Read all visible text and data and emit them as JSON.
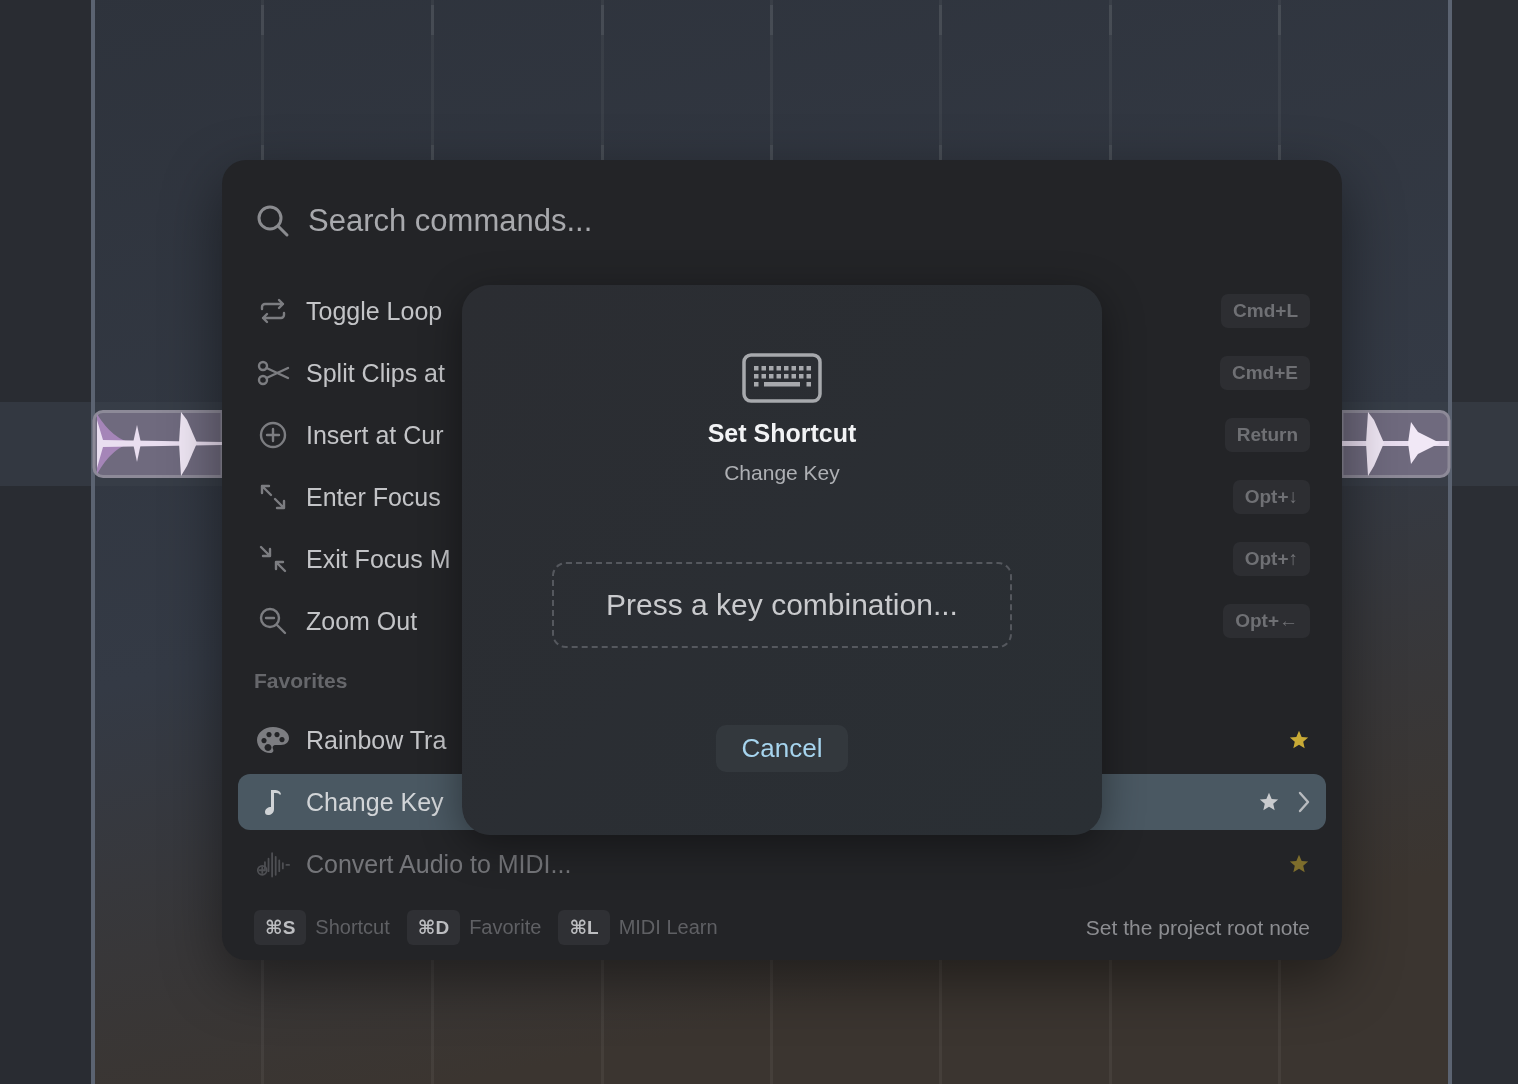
{
  "search": {
    "placeholder": "Search commands..."
  },
  "commands": [
    {
      "label": "Toggle Loop",
      "shortcut": "Cmd+L",
      "selected": false
    },
    {
      "label": "Split Clips at",
      "shortcut": "Cmd+E",
      "selected": false
    },
    {
      "label": "Insert at Cur",
      "shortcut": "Return",
      "selected": false
    },
    {
      "label": "Enter Focus",
      "shortcut": "Opt+↓",
      "selected": false
    },
    {
      "label": "Exit Focus M",
      "shortcut": "Opt+↑",
      "selected": false
    },
    {
      "label": "Zoom Out",
      "shortcut": "Opt+←",
      "selected": false
    }
  ],
  "favorites": {
    "title": "Favorites",
    "items": [
      {
        "label": "Rainbow Tra",
        "starred": true,
        "selected": false,
        "disabled": false
      },
      {
        "label": "Change Key",
        "starred": true,
        "selected": true,
        "disabled": false
      },
      {
        "label": "Convert Audio to MIDI...",
        "starred": true,
        "selected": false,
        "disabled": true
      }
    ]
  },
  "footer": {
    "hints": [
      {
        "key": "⌘S",
        "label": "Shortcut"
      },
      {
        "key": "⌘D",
        "label": "Favorite"
      },
      {
        "key": "⌘L",
        "label": "MIDI Learn"
      }
    ],
    "description": "Set the project root note"
  },
  "dialog": {
    "title": "Set Shortcut",
    "subtitle": "Change Key",
    "placeholder": "Press a key combination...",
    "cancel": "Cancel"
  }
}
